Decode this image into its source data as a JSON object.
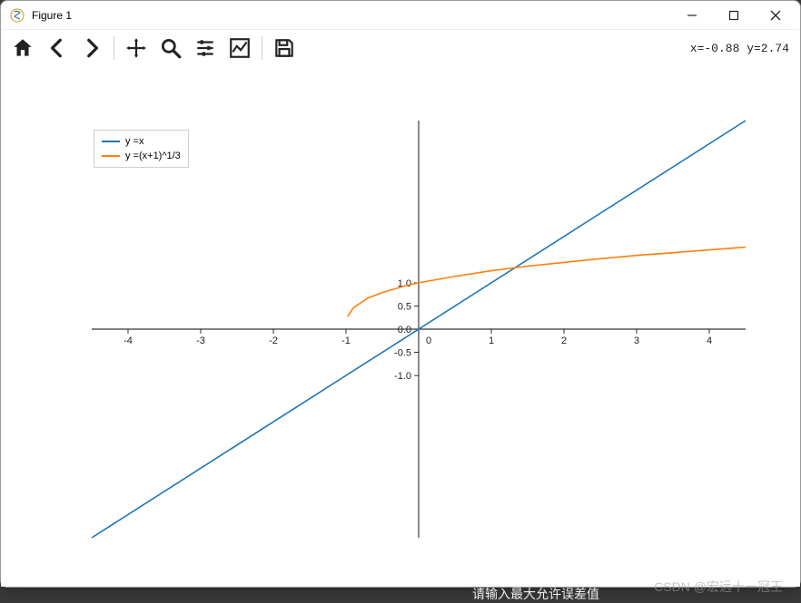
{
  "window": {
    "title": "Figure 1"
  },
  "toolbar": {
    "coords": "x=-0.88 y=2.74"
  },
  "legend": {
    "items": [
      {
        "label": "y =x",
        "color": "#1f77b4"
      },
      {
        "label": "y =(x+1)^1/3",
        "color": "#ff7f0e"
      }
    ]
  },
  "watermark": "CSDN @宏远十一冠王",
  "bottom_caption": "请输入最大允许误差值",
  "chart_data": {
    "type": "line",
    "title": "",
    "xlabel": "",
    "ylabel": "",
    "xlim": [
      -4.5,
      4.5
    ],
    "ylim": [
      -4.5,
      4.5
    ],
    "xticks": [
      -4,
      -3,
      -2,
      -1,
      0,
      1,
      2,
      3,
      4
    ],
    "yticks": [
      -1.0,
      -0.5,
      0.0,
      0.5,
      1.0
    ],
    "series": [
      {
        "name": "y =x",
        "color": "#1f77b4",
        "x": [
          -4.5,
          4.5
        ],
        "y": [
          -4.5,
          4.5
        ]
      },
      {
        "name": "y =(x+1)^1/3",
        "color": "#ff7f0e",
        "x": [
          -0.98,
          -0.9,
          -0.7,
          -0.5,
          -0.2,
          0,
          0.5,
          1,
          1.5,
          2,
          2.5,
          3,
          3.5,
          4,
          4.5
        ],
        "y": [
          0.27,
          0.46,
          0.67,
          0.79,
          0.93,
          1.0,
          1.14,
          1.26,
          1.36,
          1.44,
          1.52,
          1.59,
          1.65,
          1.71,
          1.77
        ]
      }
    ],
    "spines": {
      "top": false,
      "right": false,
      "left_at_zero": true,
      "bottom_at_zero": true
    }
  }
}
